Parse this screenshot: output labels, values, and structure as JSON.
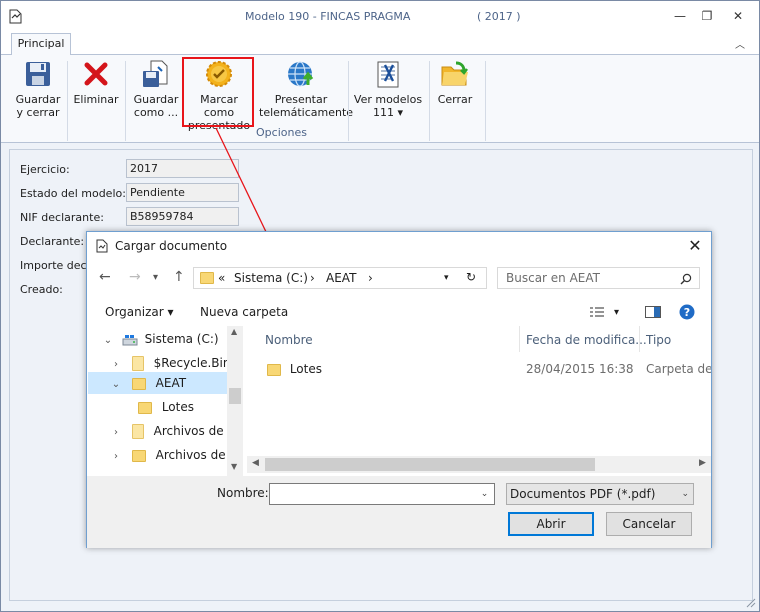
{
  "window": {
    "title": "Modelo 190 - FINCAS PRAGMA",
    "year": "( 2017 )",
    "controls": {
      "minimize": "—",
      "restore": "❐",
      "close": "✕"
    }
  },
  "tabs": [
    {
      "label": "Principal",
      "active": true
    }
  ],
  "ribbon": {
    "group_label": "Opciones",
    "buttons": [
      {
        "line1": "Guardar",
        "line2": "y cerrar"
      },
      {
        "line1": "Eliminar",
        "line2": ""
      },
      {
        "line1": "Guardar",
        "line2": "como ..."
      },
      {
        "line1": "Marcar como",
        "line2": "presentado"
      },
      {
        "line1": "Presentar",
        "line2": "telemáticamente"
      },
      {
        "line1": "Ver modelos",
        "line2": "111 ▾"
      },
      {
        "line1": "Cerrar",
        "line2": ""
      }
    ]
  },
  "form": {
    "ejercicio_label": "Ejercicio:",
    "ejercicio_value": "2017",
    "estado_label": "Estado del modelo:",
    "estado_value": "Pendiente",
    "nif_label": "NIF declarante:",
    "nif_value": "B58959784",
    "declarante_label": "Declarante:",
    "importe_label": "Importe decla",
    "creado_label": "Creado:"
  },
  "dialog": {
    "title": "Cargar documento",
    "close": "✕",
    "nav": {
      "back": "←",
      "forward": "→",
      "up": "↑"
    },
    "path": {
      "prefix": "«",
      "part1": "Sistema (C:)",
      "sep1": "›",
      "part2": "AEAT",
      "sep2": "›"
    },
    "search_placeholder": "Buscar en AEAT",
    "organize_label": "Organizar ▾",
    "new_folder_label": "Nueva carpeta",
    "tree": [
      {
        "label": "Sistema (C:)"
      },
      {
        "label": "$Recycle.Bin"
      },
      {
        "label": "AEAT"
      },
      {
        "label": "Lotes"
      },
      {
        "label": "Archivos de pr"
      },
      {
        "label": "Archivos de pr"
      }
    ],
    "columns": {
      "name": "Nombre",
      "date": "Fecha de modifica...",
      "type": "Tipo"
    },
    "files": [
      {
        "name": "Lotes",
        "date": "28/04/2015 16:38",
        "type": "Carpeta de a"
      }
    ],
    "filename_label": "Nombre:",
    "filename_value": "",
    "filetype": "Documentos PDF (*.pdf)",
    "open_label": "Abrir",
    "cancel_label": "Cancelar"
  }
}
